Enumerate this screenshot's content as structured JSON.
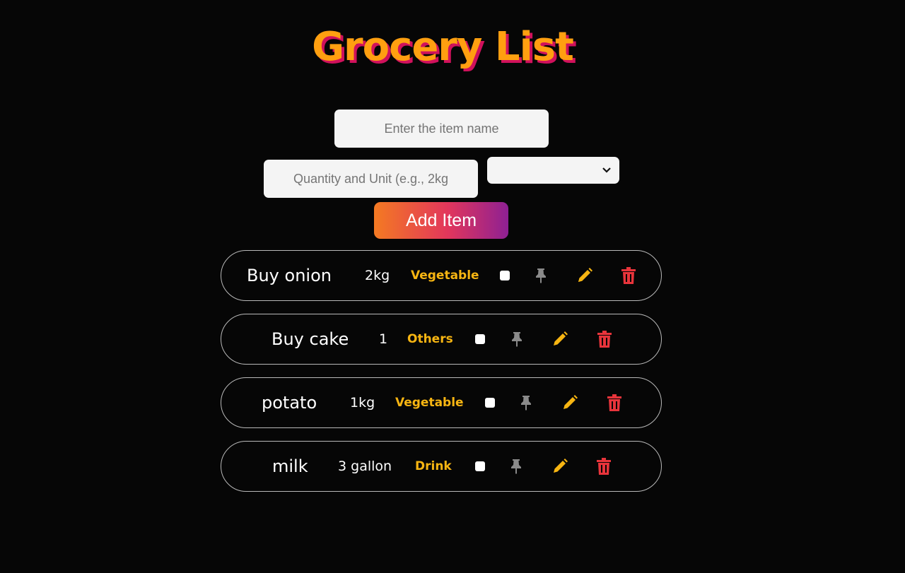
{
  "title": "Grocery List",
  "form": {
    "item_placeholder": "Enter the item name",
    "quantity_placeholder": "Quantity and Unit (e.g., 2kg",
    "category_selected": "",
    "add_button_label": "Add Item"
  },
  "colors": {
    "background": "#060606",
    "title": "#ff9f10",
    "title_shadow": "#d0115c",
    "category": "#f7b512",
    "pin": "#8a8a8a",
    "edit": "#f7b512",
    "delete": "#e8343b"
  },
  "items": [
    {
      "name": "Buy onion",
      "quantity": "2kg",
      "category": "Vegetable",
      "checked": false,
      "icons": [
        "pin-icon",
        "pencil-icon",
        "trash-icon"
      ]
    },
    {
      "name": "Buy cake",
      "quantity": "1",
      "category": "Others",
      "checked": false,
      "icons": [
        "pin-icon",
        "pencil-icon",
        "trash-icon"
      ]
    },
    {
      "name": "potato",
      "quantity": "1kg",
      "category": "Vegetable",
      "checked": false,
      "icons": [
        "pin-icon",
        "pencil-icon",
        "trash-icon"
      ]
    },
    {
      "name": "milk",
      "quantity": "3 gallon",
      "category": "Drink",
      "checked": false,
      "icons": [
        "pin-icon",
        "pencil-icon",
        "trash-icon"
      ]
    }
  ]
}
